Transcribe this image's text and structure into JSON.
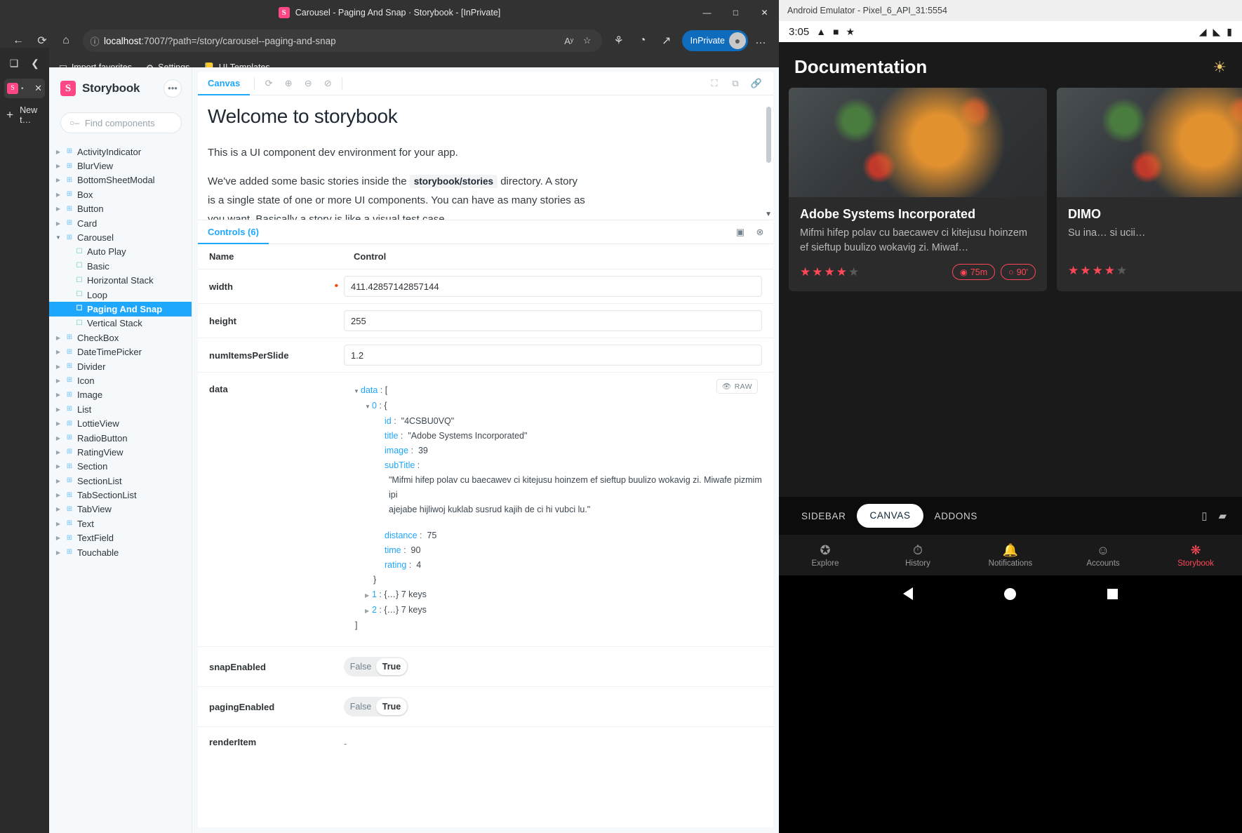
{
  "browser": {
    "window_title": "Carousel - Paging And Snap · Storybook - [InPrivate]",
    "favicon": "S",
    "minimize": "—",
    "maximize": "□",
    "close": "✕",
    "nav": {
      "back": "←",
      "refresh": "⟳",
      "home": "⌂",
      "lock_icon": "ⓘ",
      "url_host": "localhost",
      "url_path": ":7007/?path=/story/carousel--paging-and-snap",
      "read_aloud": "Aʸ",
      "favorite": "☆",
      "collections": "⚘",
      "browser_essentials": "◔",
      "share": "↗",
      "profile_label": "InPrivate",
      "profile_avatar": "👤",
      "settings_more": "…"
    },
    "bookmarks": [
      {
        "icon": "⬓",
        "label": "Import favorites"
      },
      {
        "icon": "⚙",
        "label": "Settings"
      },
      {
        "icon": "📒",
        "label": "UI Templates"
      }
    ],
    "tabstrip": {
      "tab_actions_icon": "❑",
      "collapse_icon": "❮",
      "tab_favicon": "S",
      "tab_dot": "•",
      "tab_close": "✕",
      "new_tab_plus": "+",
      "new_tab_label": "New t…"
    }
  },
  "storybook": {
    "brand": {
      "logo": "S",
      "name": "Storybook",
      "menu": "•••"
    },
    "search": {
      "placeholder": "Find components",
      "shortcut": "/",
      "icon": "search-icon",
      "value": ""
    },
    "tree": [
      {
        "label": "ActivityIndicator",
        "type": "component",
        "depth": 0,
        "expanded": false,
        "selected": false
      },
      {
        "label": "BlurView",
        "type": "component",
        "depth": 0,
        "expanded": false,
        "selected": false
      },
      {
        "label": "BottomSheetModal",
        "type": "component",
        "depth": 0,
        "expanded": false,
        "selected": false
      },
      {
        "label": "Box",
        "type": "component",
        "depth": 0,
        "expanded": false,
        "selected": false
      },
      {
        "label": "Button",
        "type": "component",
        "depth": 0,
        "expanded": false,
        "selected": false
      },
      {
        "label": "Card",
        "type": "component",
        "depth": 0,
        "expanded": false,
        "selected": false
      },
      {
        "label": "Carousel",
        "type": "component",
        "depth": 0,
        "expanded": true,
        "selected": false
      },
      {
        "label": "Auto Play",
        "type": "story",
        "depth": 1,
        "expanded": false,
        "selected": false
      },
      {
        "label": "Basic",
        "type": "story",
        "depth": 1,
        "expanded": false,
        "selected": false
      },
      {
        "label": "Horizontal Stack",
        "type": "story",
        "depth": 1,
        "expanded": false,
        "selected": false
      },
      {
        "label": "Loop",
        "type": "story",
        "depth": 1,
        "expanded": false,
        "selected": false
      },
      {
        "label": "Paging And Snap",
        "type": "story",
        "depth": 1,
        "expanded": false,
        "selected": true
      },
      {
        "label": "Vertical Stack",
        "type": "story",
        "depth": 1,
        "expanded": false,
        "selected": false
      },
      {
        "label": "CheckBox",
        "type": "component",
        "depth": 0,
        "expanded": false,
        "selected": false
      },
      {
        "label": "DateTimePicker",
        "type": "component",
        "depth": 0,
        "expanded": false,
        "selected": false
      },
      {
        "label": "Divider",
        "type": "component",
        "depth": 0,
        "expanded": false,
        "selected": false
      },
      {
        "label": "Icon",
        "type": "component",
        "depth": 0,
        "expanded": false,
        "selected": false
      },
      {
        "label": "Image",
        "type": "component",
        "depth": 0,
        "expanded": false,
        "selected": false
      },
      {
        "label": "List",
        "type": "component",
        "depth": 0,
        "expanded": false,
        "selected": false
      },
      {
        "label": "LottieView",
        "type": "component",
        "depth": 0,
        "expanded": false,
        "selected": false
      },
      {
        "label": "RadioButton",
        "type": "component",
        "depth": 0,
        "expanded": false,
        "selected": false
      },
      {
        "label": "RatingView",
        "type": "component",
        "depth": 0,
        "expanded": false,
        "selected": false
      },
      {
        "label": "Section",
        "type": "component",
        "depth": 0,
        "expanded": false,
        "selected": false
      },
      {
        "label": "SectionList",
        "type": "component",
        "depth": 0,
        "expanded": false,
        "selected": false
      },
      {
        "label": "TabSectionList",
        "type": "component",
        "depth": 0,
        "expanded": false,
        "selected": false
      },
      {
        "label": "TabView",
        "type": "component",
        "depth": 0,
        "expanded": false,
        "selected": false
      },
      {
        "label": "Text",
        "type": "component",
        "depth": 0,
        "expanded": false,
        "selected": false
      },
      {
        "label": "TextField",
        "type": "component",
        "depth": 0,
        "expanded": false,
        "selected": false
      },
      {
        "label": "Touchable",
        "type": "component",
        "depth": 0,
        "expanded": false,
        "selected": false
      }
    ],
    "canvas_toolbar": {
      "tab_label": "Canvas",
      "remount_icon": "⟳",
      "zoom_in_icon": "⊕",
      "zoom_out_icon": "⊖",
      "zoom_reset_icon": "⊘",
      "fullscreen_icon": "⛶",
      "open_new_tab_icon": "⧉",
      "copy_link_icon": "🔗"
    },
    "preview": {
      "heading": "Welcome to storybook",
      "p1": "This is a UI component dev environment for your app.",
      "p2_before": "We've added some basic stories inside the",
      "p2_code": "storybook/stories",
      "p2_after": "directory. A story is a single state of one or more UI components. You can have as many stories as you want. Basically a story is like a visual test case.",
      "scroll_arrow": "▼"
    },
    "controls": {
      "tab_label": "Controls (6)",
      "split_icon": "▣",
      "close_icon": "⊗",
      "reset_icon": "↩",
      "col_name": "Name",
      "col_control": "Control",
      "rows": [
        {
          "name": "width",
          "required": true,
          "type": "text",
          "value": "411.42857142857144"
        },
        {
          "name": "height",
          "required": false,
          "type": "text",
          "value": "255"
        },
        {
          "name": "numItemsPerSlide",
          "required": false,
          "type": "text",
          "value": "1.2"
        },
        {
          "name": "data",
          "required": false,
          "type": "object"
        },
        {
          "name": "snapEnabled",
          "required": false,
          "type": "boolean",
          "false_label": "False",
          "true_label": "True",
          "value": "True"
        },
        {
          "name": "pagingEnabled",
          "required": false,
          "type": "boolean",
          "false_label": "False",
          "true_label": "True",
          "value": "True"
        },
        {
          "name": "renderItem",
          "required": false,
          "type": "dash",
          "value": "-"
        }
      ],
      "object_viewer": {
        "raw_label": "RAW",
        "raw_eye": "👁",
        "root_key": "data",
        "root_open": "[",
        "root_close": "]",
        "item0_key": "0",
        "item0_open": "{",
        "item0_close": "}",
        "fields": [
          {
            "key": "id",
            "value": "\"4CSBU0VQ\""
          },
          {
            "key": "title",
            "value": "\"Adobe Systems Incorporated\""
          },
          {
            "key": "image",
            "value": "39"
          }
        ],
        "subtitle_key": "subTitle",
        "subtitle_line1": "\"Mifmi hifep polav cu baecawev ci kitejusu hoinzem ef sieftup buulizo wokavig zi. Miwafe pizmim ipi",
        "subtitle_line2": "ajejabe hijliwoj kuklab susrud kajih de ci hi vubci lu.\"",
        "fields2": [
          {
            "key": "distance",
            "value": "75"
          },
          {
            "key": "time",
            "value": "90"
          },
          {
            "key": "rating",
            "value": "4"
          }
        ],
        "collapsed": [
          {
            "key": "1",
            "value": "{…} 7 keys"
          },
          {
            "key": "2",
            "value": "{…} 7 keys"
          }
        ]
      }
    }
  },
  "emulator": {
    "window_title": "Android Emulator - Pixel_6_API_31:5554",
    "status": {
      "time": "3:05",
      "icons": [
        "android-studio-icon",
        "sdcard-icon",
        "bug-icon"
      ],
      "right_icons": [
        "wifi-icon",
        "signal-icon",
        "battery-icon"
      ]
    },
    "app": {
      "title": "Documentation",
      "theme_icon": "☀",
      "cards": [
        {
          "title": "Adobe Systems Incorporated",
          "subtitle": "Mifmi hifep polav cu baecawev ci kitejusu hoinzem ef sieftup buulizo wokavig zi. Miwaf…",
          "rating": 4,
          "max_rating": 5,
          "distance": "75m",
          "time": "90'",
          "distance_icon": "📍",
          "time_icon": "🕐"
        },
        {
          "title": "DIMO",
          "subtitle": "Su ina… si ucii…",
          "rating": 4,
          "max_rating": 5,
          "distance": "",
          "time": "",
          "distance_icon": "",
          "time_icon": ""
        }
      ]
    },
    "storybook_bar": {
      "items": [
        "SIDEBAR",
        "CANVAS",
        "ADDONS"
      ],
      "active": "CANVAS",
      "right_icons": [
        "layout-icon",
        "desktop-icon"
      ]
    },
    "tabbar": [
      {
        "label": "Explore",
        "icon": "compass-icon",
        "active": false
      },
      {
        "label": "History",
        "icon": "clock-icon",
        "active": false
      },
      {
        "label": "Notifications",
        "icon": "bell-icon",
        "active": false
      },
      {
        "label": "Accounts",
        "icon": "person-icon",
        "active": false
      },
      {
        "label": "Storybook",
        "icon": "storybook-icon",
        "active": true
      }
    ],
    "navbar": {
      "back": "back-triangle-icon",
      "home": "home-circle-icon",
      "recents": "recents-square-icon"
    }
  },
  "colors": {
    "accent": "#1ea7fd",
    "brand": "#ff4785",
    "edge_blue": "#0f6cbd",
    "red": "#ff4757"
  }
}
